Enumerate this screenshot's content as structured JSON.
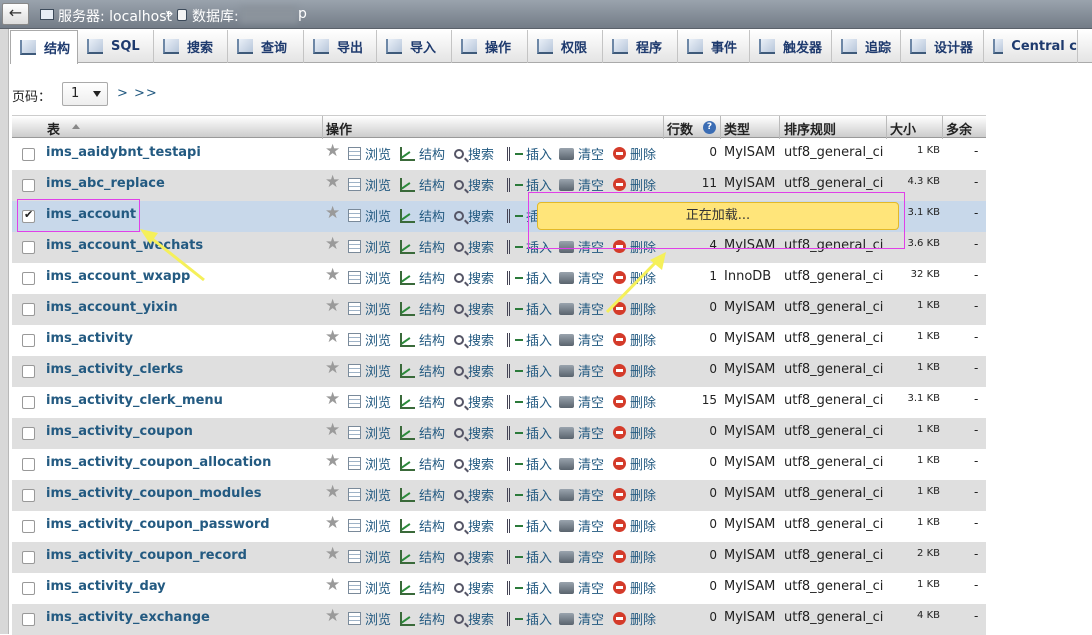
{
  "breadcrumb": {
    "server_label": "服务器: localhost",
    "separator": "»",
    "db_label": "数据库:",
    "db_tail": "p"
  },
  "tabs": [
    {
      "label": "结构",
      "icon": "structure-icon",
      "active": true
    },
    {
      "label": "SQL",
      "icon": "sql-icon"
    },
    {
      "label": "搜索",
      "icon": "search-icon"
    },
    {
      "label": "查询",
      "icon": "query-icon"
    },
    {
      "label": "导出",
      "icon": "export-icon"
    },
    {
      "label": "导入",
      "icon": "import-icon"
    },
    {
      "label": "操作",
      "icon": "wrench-icon"
    },
    {
      "label": "权限",
      "icon": "privileges-icon"
    },
    {
      "label": "程序",
      "icon": "routines-icon"
    },
    {
      "label": "事件",
      "icon": "clock-icon"
    },
    {
      "label": "触发器",
      "icon": "triggers-icon"
    },
    {
      "label": "追踪",
      "icon": "eye-icon"
    },
    {
      "label": "设计器",
      "icon": "designer-icon"
    },
    {
      "label": "Central c",
      "icon": "central-columns-icon"
    }
  ],
  "pager": {
    "label": "页码：",
    "value": "1",
    "next": "> >>"
  },
  "table_headers": {
    "table": "表",
    "actions": "操作",
    "rows": "行数",
    "type": "类型",
    "collation": "排序规则",
    "size": "大小",
    "overhead": "多余"
  },
  "action_labels": {
    "browse": "浏览",
    "structure": "结构",
    "search": "搜索",
    "insert": "插入",
    "empty": "清空",
    "drop": "删除"
  },
  "rows": [
    {
      "name": "ims_aaidybnt_testapi",
      "rows": "0",
      "engine": "MyISAM",
      "collation": "utf8_general_ci",
      "size": "1 KB",
      "overhead": "-"
    },
    {
      "name": "ims_abc_replace",
      "rows": "11",
      "engine": "MyISAM",
      "collation": "utf8_general_ci",
      "size": "4.3 KB",
      "overhead": "-"
    },
    {
      "name": "ims_account",
      "rows": "",
      "engine": "",
      "collation": "",
      "size": "3.1 KB",
      "overhead": "-",
      "selected": true
    },
    {
      "name": "ims_account_wechats",
      "rows": "4",
      "engine": "MyISAM",
      "collation": "utf8_general_ci",
      "size": "3.6 KB",
      "overhead": "-"
    },
    {
      "name": "ims_account_wxapp",
      "rows": "1",
      "engine": "InnoDB",
      "collation": "utf8_general_ci",
      "size": "32 KB",
      "overhead": "-"
    },
    {
      "name": "ims_account_yixin",
      "rows": "0",
      "engine": "MyISAM",
      "collation": "utf8_general_ci",
      "size": "1 KB",
      "overhead": "-"
    },
    {
      "name": "ims_activity",
      "rows": "0",
      "engine": "MyISAM",
      "collation": "utf8_general_ci",
      "size": "1 KB",
      "overhead": "-"
    },
    {
      "name": "ims_activity_clerks",
      "rows": "0",
      "engine": "MyISAM",
      "collation": "utf8_general_ci",
      "size": "1 KB",
      "overhead": "-"
    },
    {
      "name": "ims_activity_clerk_menu",
      "rows": "15",
      "engine": "MyISAM",
      "collation": "utf8_general_ci",
      "size": "3.1 KB",
      "overhead": "-"
    },
    {
      "name": "ims_activity_coupon",
      "rows": "0",
      "engine": "MyISAM",
      "collation": "utf8_general_ci",
      "size": "1 KB",
      "overhead": "-"
    },
    {
      "name": "ims_activity_coupon_allocation",
      "rows": "0",
      "engine": "MyISAM",
      "collation": "utf8_general_ci",
      "size": "1 KB",
      "overhead": "-"
    },
    {
      "name": "ims_activity_coupon_modules",
      "rows": "0",
      "engine": "MyISAM",
      "collation": "utf8_general_ci",
      "size": "1 KB",
      "overhead": "-"
    },
    {
      "name": "ims_activity_coupon_password",
      "rows": "0",
      "engine": "MyISAM",
      "collation": "utf8_general_ci",
      "size": "1 KB",
      "overhead": "-"
    },
    {
      "name": "ims_activity_coupon_record",
      "rows": "0",
      "engine": "MyISAM",
      "collation": "utf8_general_ci",
      "size": "2 KB",
      "overhead": "-"
    },
    {
      "name": "ims_activity_day",
      "rows": "0",
      "engine": "MyISAM",
      "collation": "utf8_general_ci",
      "size": "1 KB",
      "overhead": "-"
    },
    {
      "name": "ims_activity_exchange",
      "rows": "0",
      "engine": "MyISAM",
      "collation": "utf8_general_ci",
      "size": "4 KB",
      "overhead": "-"
    }
  ],
  "loading": {
    "text": "正在加载..."
  },
  "colors": {
    "link": "#235a81",
    "toast": "#ffe57a",
    "highlight": "#e040e8",
    "arrow": "#f5f05a",
    "selected_row": "#c8d8ea"
  }
}
